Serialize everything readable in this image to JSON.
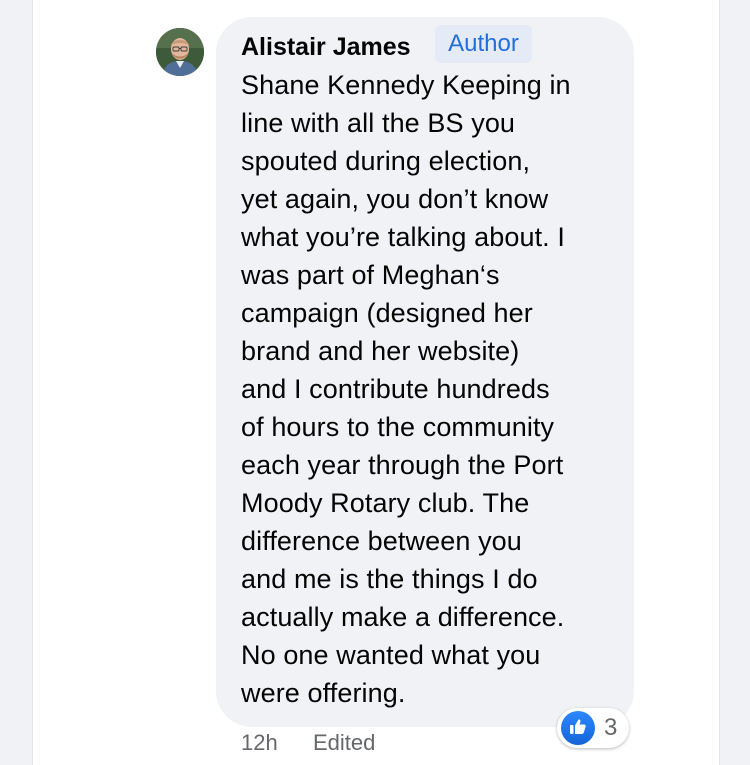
{
  "comment": {
    "author_name": "Alistair James",
    "author_badge": "Author",
    "text": "Shane Kennedy Keeping in\nline with all the BS you\nspouted during election,\nyet again, you don’t know\nwhat you’re talking about. I\nwas part of Meghan‘s\ncampaign (designed her\nbrand and her website)\nand I contribute hundreds\nof hours to the community\neach year through the Port\nMoody Rotary club. The\ndifference between you\nand me is the things I do\nactually make a difference.\nNo one wanted what you\nwere offering.",
    "time": "12h",
    "edited_label": "Edited",
    "reaction": {
      "icon": "thumbs-up-icon",
      "count": "3"
    }
  },
  "colors": {
    "background": "#f0f2f5",
    "bubble": "#f0f2f5",
    "badge_bg": "#e4ebf7",
    "badge_text": "#216fdb",
    "like_blue": "#1877f2",
    "meta_text": "#65676b"
  }
}
